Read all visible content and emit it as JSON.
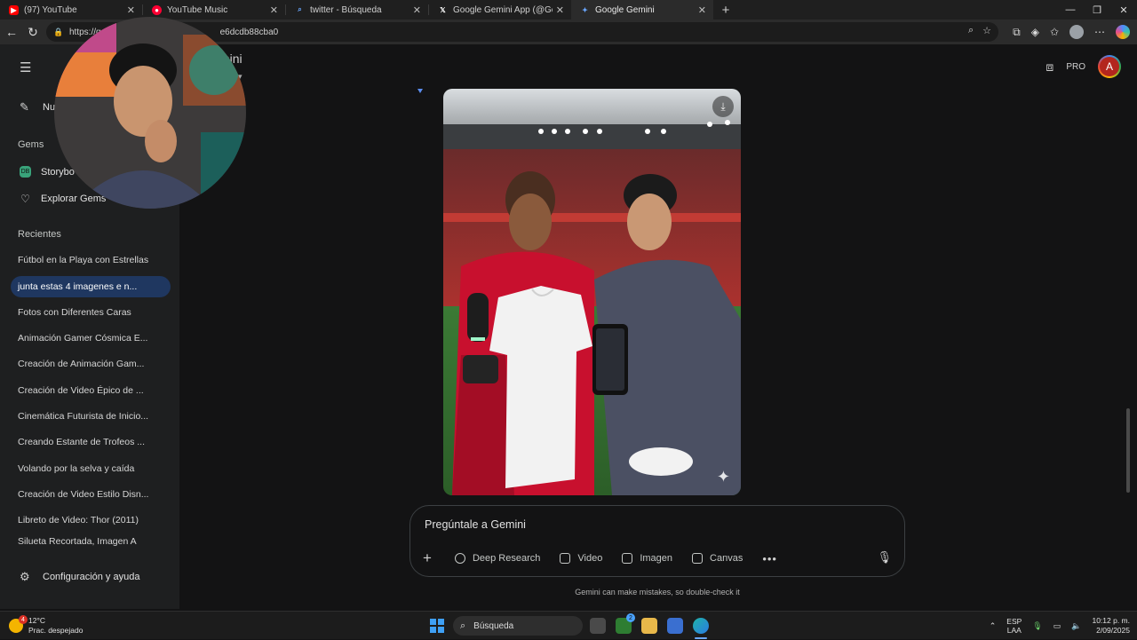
{
  "browser": {
    "tabs": [
      {
        "label": "(97) YouTube",
        "favicon_color": "#ff0000",
        "active": false
      },
      {
        "label": "YouTube Music",
        "favicon_color": "#ff0033",
        "active": false
      },
      {
        "label": "twitter - Búsqueda",
        "favicon_color": "#3b82f6",
        "active": false
      },
      {
        "label": "Google Gemini App (@GeminiAp",
        "favicon_color": "#ffffff",
        "active": false
      },
      {
        "label": "Google Gemini",
        "favicon_color": "#4f8cff",
        "active": true
      }
    ],
    "url_left": "https://g",
    "url_right": "e6dcdb88cba0"
  },
  "sidebar": {
    "new_chat_label": "Nu",
    "gems_title": "Gems",
    "gems": [
      {
        "label": "Storybo",
        "icon_color": "#39a37a",
        "icon_text": "DB"
      },
      {
        "label": "Explorar Gems",
        "icon_color": "",
        "icon_text": ""
      }
    ],
    "recent_title": "Recientes",
    "recent": [
      {
        "label": "Fútbol en la Playa con Estrellas",
        "active": false
      },
      {
        "label": "junta estas 4 imagenes e n...",
        "active": true
      },
      {
        "label": "Fotos con Diferentes Caras",
        "active": false
      },
      {
        "label": "Animación Gamer Cósmica E...",
        "active": false
      },
      {
        "label": "Creación de Animación Gam...",
        "active": false
      },
      {
        "label": "Creación de Video Épico de ...",
        "active": false
      },
      {
        "label": "Cinemática Futurista de Inicio...",
        "active": false
      },
      {
        "label": "Creando Estante de Trofeos ...",
        "active": false
      },
      {
        "label": "Volando por la selva y caída",
        "active": false
      },
      {
        "label": "Creación de Video Estilo Disn...",
        "active": false
      },
      {
        "label": "Libreto de Video: Thor (2011)",
        "active": false
      },
      {
        "label": "Silueta Recortada, Imagen A",
        "active": false
      }
    ],
    "settings_label": "Configuración y ayuda"
  },
  "header": {
    "app_title_fragment": "mini",
    "pro_label": "PRO",
    "avatar_letter": "A"
  },
  "composer": {
    "placeholder": "Pregúntale a Gemini",
    "tools": [
      "Deep Research",
      "Video",
      "Imagen",
      "Canvas"
    ],
    "disclaimer": "Gemini can make mistakes, so double-check it"
  },
  "taskbar": {
    "weather_badge": "4",
    "temperature": "12°C",
    "condition": "Prac. despejado",
    "search_label": "Búsqueda",
    "xbox_badge": "2",
    "lang_top": "ESP",
    "lang_bottom": "LAA",
    "time": "10:12 p. m.",
    "date": "2/09/2025"
  },
  "icons": {
    "back": "arrow-left-icon",
    "reload": "reload-icon",
    "menu": "hamburger-icon",
    "settings": "gear-icon",
    "download": "download-icon",
    "mic": "mic-icon"
  }
}
